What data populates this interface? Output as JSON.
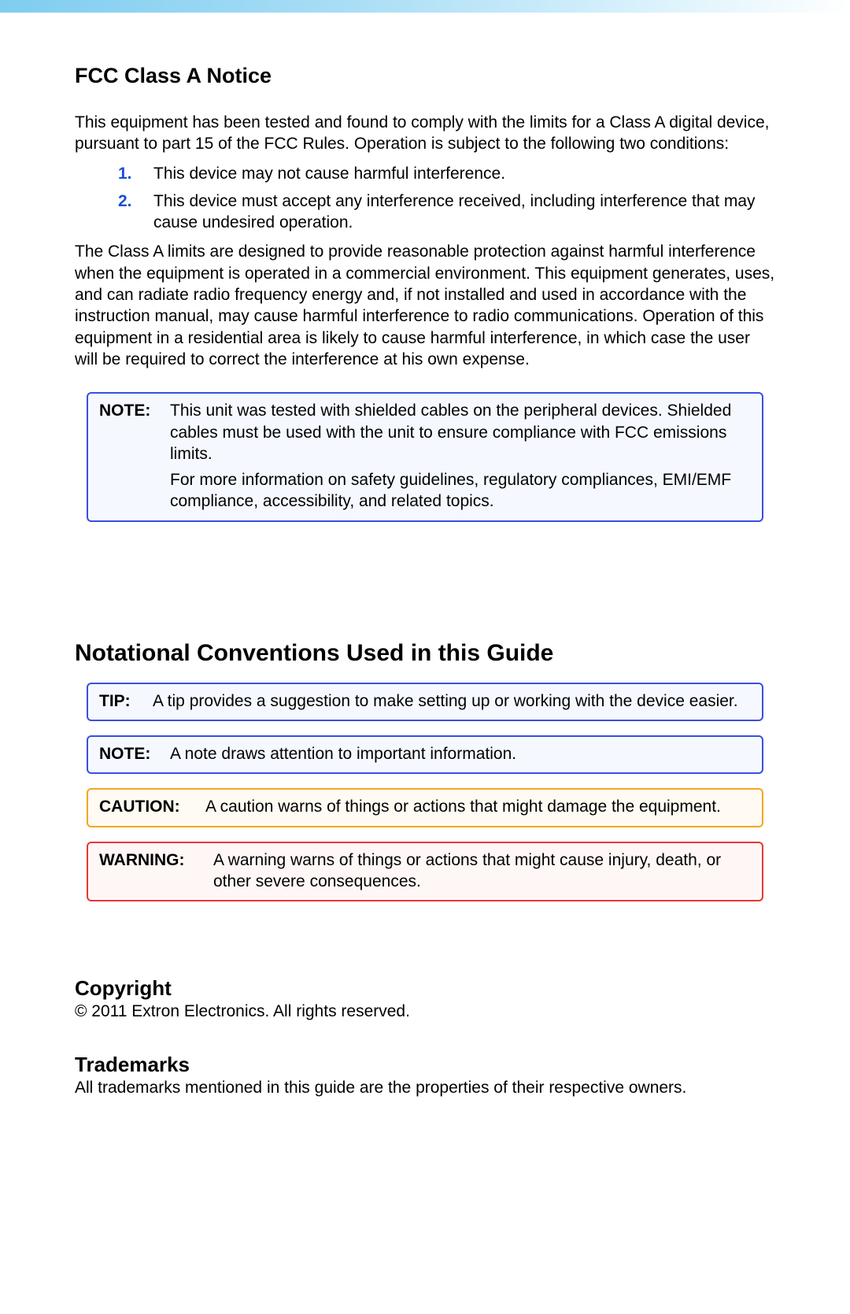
{
  "fcc": {
    "heading": "FCC Class A Notice",
    "intro": "This equipment has been tested and found to comply with the limits for a Class A digital device, pursuant to part 15 of the FCC Rules. Operation is subject to the following two conditions:",
    "conditions": [
      {
        "num": "1.",
        "text": "This device may not cause harmful interference."
      },
      {
        "num": "2.",
        "text": "This device must accept any interference received, including interference that may cause undesired operation."
      }
    ],
    "body": "The Class A limits are designed to provide reasonable protection against harmful interference when the equipment is operated in a commercial environment. This equipment generates, uses, and can radiate radio frequency energy and, if not installed and used in accordance with the instruction manual, may cause harmful interference to radio communications. Operation of this equipment in a residential area is likely to cause harmful interference, in which case the user will be required to correct the interference at his own expense.",
    "note": {
      "label": "NOTE:",
      "p1": "This unit was tested with shielded cables on the peripheral devices. Shielded cables must be used with the unit to ensure compliance with FCC emissions limits.",
      "p2": "For more information on safety guidelines, regulatory compliances, EMI/EMF compliance, accessibility, and related topics."
    }
  },
  "conventions": {
    "heading": "Notational Conventions Used in this Guide",
    "tip": {
      "label": "TIP:",
      "text": "A tip provides a suggestion to make setting up or working with the device easier."
    },
    "note": {
      "label": "NOTE:",
      "text": "A note draws attention to important information."
    },
    "caution": {
      "label": "CAUTION:",
      "text": "A caution warns of things or actions that might damage the equipment."
    },
    "warning": {
      "label": "WARNING:",
      "text": "A warning warns of things or actions that might cause injury, death, or other severe consequences."
    }
  },
  "copyright": {
    "heading": "Copyright",
    "text": "© 2011  Extron Electronics.  All rights reserved."
  },
  "trademarks": {
    "heading": "Trademarks",
    "text": "All trademarks mentioned in this guide are the properties of their respective owners."
  }
}
